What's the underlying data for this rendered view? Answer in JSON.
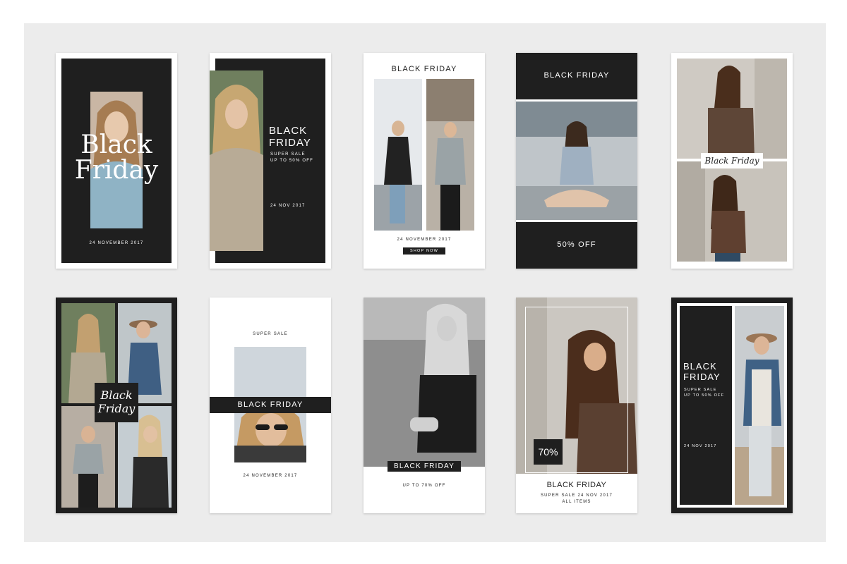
{
  "colors": {
    "background": "#ececec",
    "dark": "#1f1f1f",
    "white": "#ffffff"
  },
  "cards": [
    {
      "headline_line1": "Black",
      "headline_line2": "Friday",
      "date": "24 NOVEMBER 2017"
    },
    {
      "headline_line1": "BLACK",
      "headline_line2": "FRIDAY",
      "sub1": "SUPER SALE",
      "sub2": "UP TO 50% OFF",
      "date": "24 NOV 2017"
    },
    {
      "headline": "BLACK FRIDAY",
      "date": "24 NOVEMBER 2017",
      "button": "SHOP NOW"
    },
    {
      "headline": "BLACK FRIDAY",
      "offer": "50% OFF"
    },
    {
      "label": "Black Friday"
    },
    {
      "label_line1": "Black",
      "label_line2": "Friday"
    },
    {
      "top": "SUPER SALE",
      "band": "BLACK FRIDAY",
      "date": "24 NOVEMBER 2017"
    },
    {
      "band": "BLACK FRIDAY",
      "sub": "UP TO 70% OFF"
    },
    {
      "badge": "70%",
      "headline": "BLACK FRIDAY",
      "sub1": "SUPER SALE 24 NOV 2017",
      "sub2": "ALL ITEMS"
    },
    {
      "headline_line1": "BLACK",
      "headline_line2": "FRIDAY",
      "sub1": "SUPER SALE",
      "sub2": "UP TO 50% OFF",
      "date": "24 NOV 2017"
    }
  ]
}
